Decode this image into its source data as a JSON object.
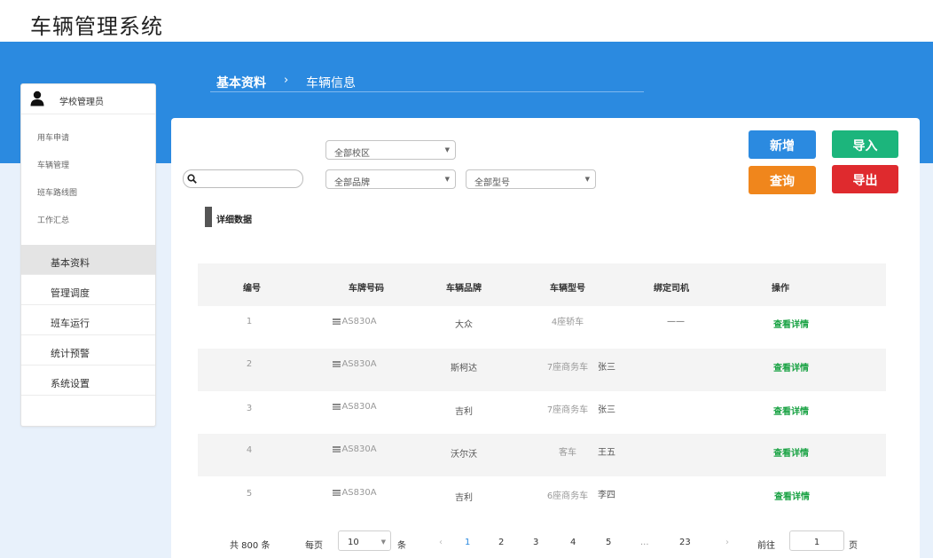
{
  "app": {
    "title": "车辆管理系统"
  },
  "breadcrumb": {
    "level1": "基本资料",
    "separator": "›",
    "level2": "车辆信息"
  },
  "sidebar": {
    "user": {
      "name": "学校管理员",
      "icon": "user-icon"
    },
    "quick_links": [
      "用车申请",
      "车辆管理",
      "班车路线图",
      "工作汇总"
    ],
    "nav": [
      {
        "label": "基本资料",
        "active": true
      },
      {
        "label": "管理调度",
        "active": false
      },
      {
        "label": "班车运行",
        "active": false
      },
      {
        "label": "统计预警",
        "active": false
      },
      {
        "label": "系统设置",
        "active": false
      }
    ]
  },
  "filters": {
    "campus": "全部校区",
    "brand": "全部品牌",
    "model": "全部型号",
    "search_value": ""
  },
  "buttons": {
    "add": {
      "label": "新增",
      "color": "#2b8ae0"
    },
    "import": {
      "label": "导入",
      "color": "#1cb57c"
    },
    "query": {
      "label": "查询",
      "color": "#f0861c"
    },
    "export": {
      "label": "导出",
      "color": "#df2a2e"
    }
  },
  "section": {
    "title": "详细数据"
  },
  "table": {
    "headers": [
      "编号",
      "车牌号码",
      "车辆品牌",
      "车辆型号",
      "绑定司机",
      "操作"
    ],
    "rows": [
      {
        "id": "1",
        "plate": "AS830A",
        "brand": "大众",
        "model": "4座轿车",
        "driver": "——",
        "action": "查看详情"
      },
      {
        "id": "2",
        "plate": "AS830A",
        "brand": "斯柯达",
        "model": "7座商务车",
        "driver": "张三",
        "action": "查看详情"
      },
      {
        "id": "3",
        "plate": "AS830A",
        "brand": "吉利",
        "model": "7座商务车",
        "driver": "张三",
        "action": "查看详情"
      },
      {
        "id": "4",
        "plate": "AS830A",
        "brand": "沃尔沃",
        "model": "客车",
        "driver": "王五",
        "action": "查看详情"
      },
      {
        "id": "5",
        "plate": "AS830A",
        "brand": "吉利",
        "model": "6座商务车",
        "driver": "李四",
        "action": "查看详情"
      }
    ]
  },
  "pagination": {
    "total": "共 800 条",
    "per_page_label": "每页",
    "per_page": "10",
    "unit": "条",
    "prev": "‹",
    "pages": [
      "1",
      "2",
      "3",
      "4",
      "5",
      "...",
      "23"
    ],
    "current": "1",
    "next": "›",
    "goto_label": "前往",
    "goto_value": "1",
    "page_unit": "页"
  }
}
